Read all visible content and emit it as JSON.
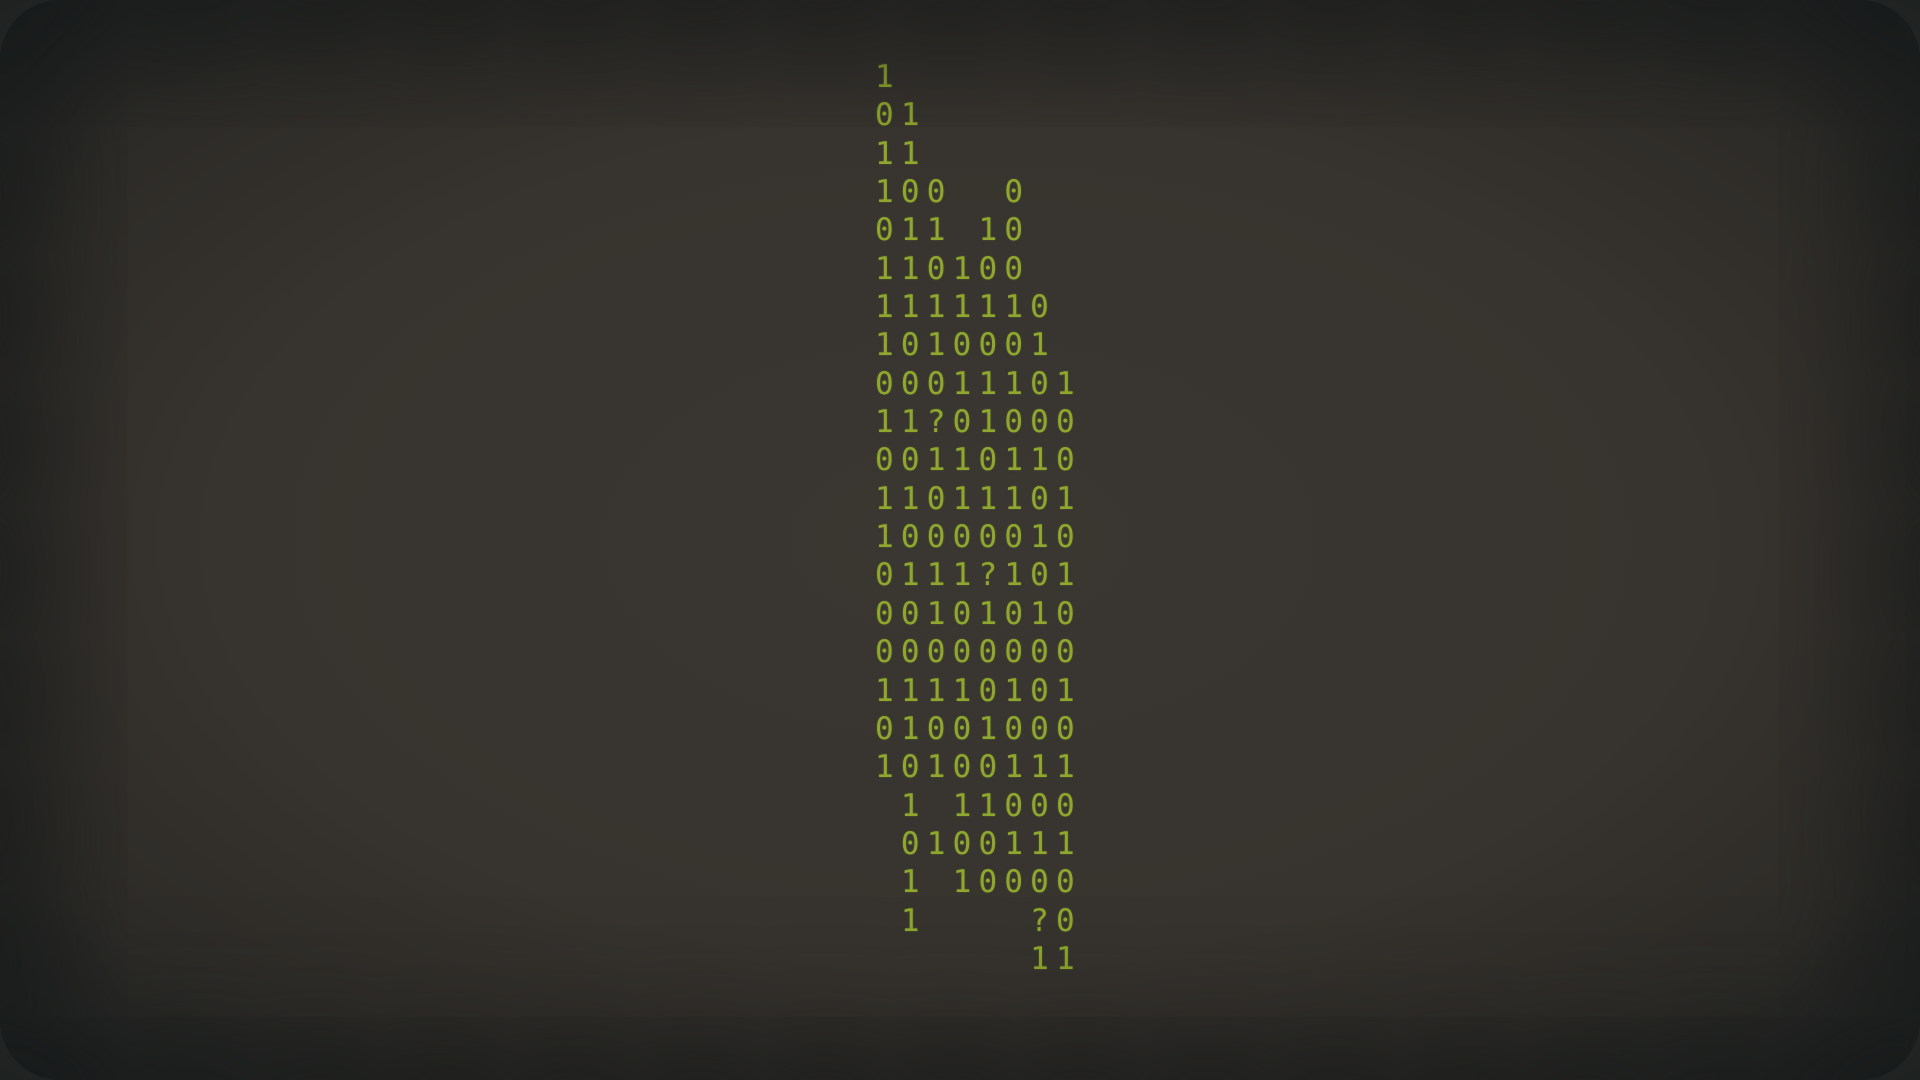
{
  "binary_rows": [
    "1",
    "01",
    "11",
    "100  0",
    "011 10",
    "110100",
    "1111110",
    "1010001",
    "00011101",
    "11?01000",
    "00110110",
    "11011101",
    "10000010",
    "0111?101",
    "00101010",
    "00000000",
    "11110101",
    "01001000",
    "10100111",
    " 1 11000",
    " 0100111",
    " 1 10000",
    " 1    ?0",
    "      11"
  ],
  "colors": {
    "text": "#8fa72e",
    "background": "#37332e",
    "vignette": "#1e2221"
  }
}
